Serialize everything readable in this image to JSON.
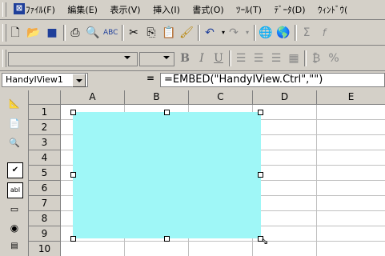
{
  "menubar": {
    "items": [
      "ﾌｧｲﾙ(F)",
      "編集(E)",
      "表示(V)",
      "挿入(I)",
      "書式(O)",
      "ﾂｰﾙ(T)",
      "ﾃﾞｰﾀ(D)",
      "ｳｨﾝﾄﾞｳ("
    ]
  },
  "standard_toolbar": {
    "icons": [
      "new-icon",
      "open-icon",
      "save-icon",
      "print-icon",
      "print-preview-icon",
      "spelling-icon",
      "cut-icon",
      "copy-icon",
      "paste-icon",
      "format-painter-icon",
      "undo-icon",
      "redo-icon",
      "hyperlink-icon",
      "web-toolbar-icon",
      "autosum-icon",
      "function-icon"
    ]
  },
  "formatting_toolbar": {
    "bold": "B",
    "italic": "I",
    "underline": "U",
    "percent": "%"
  },
  "formula_bar": {
    "name_box": "HandyIView1",
    "equals": "=",
    "formula": "=EMBED(\"HandyIView.Ctrl\",\"\")"
  },
  "grid": {
    "columns": [
      "A",
      "B",
      "C",
      "D",
      "E"
    ],
    "rows": [
      "1",
      "2",
      "3",
      "4",
      "5",
      "6",
      "7",
      "8",
      "9",
      "10"
    ]
  },
  "embedded_object": {
    "color": "#9ff7f7"
  }
}
